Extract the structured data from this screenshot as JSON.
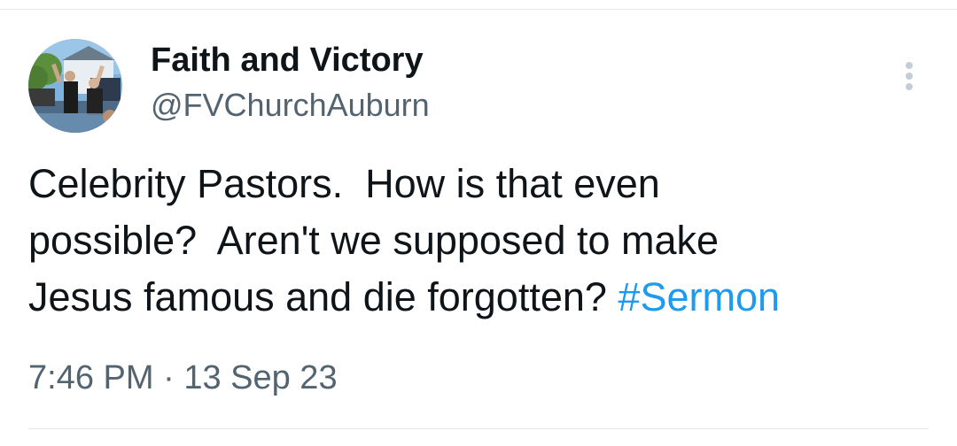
{
  "tweet": {
    "author": {
      "display_name": "Faith and Victory",
      "handle": "@FVChurchAuburn"
    },
    "text_lines": [
      "Celebrity Pastors.  How is that even",
      "possible?  Aren't we supposed to make",
      "Jesus famous and die forgotten? "
    ],
    "hashtag": "#Sermon",
    "time": "7:46 PM",
    "separator": " · ",
    "date": "13 Sep 23"
  },
  "icons": {
    "more": "more-vertical-icon",
    "avatar": "profile-photo"
  },
  "colors": {
    "text_primary": "#0f1419",
    "text_secondary": "#536471",
    "link": "#1d9bf0",
    "divider": "#e6e9ec",
    "more_icon": "#c4cdd4"
  }
}
